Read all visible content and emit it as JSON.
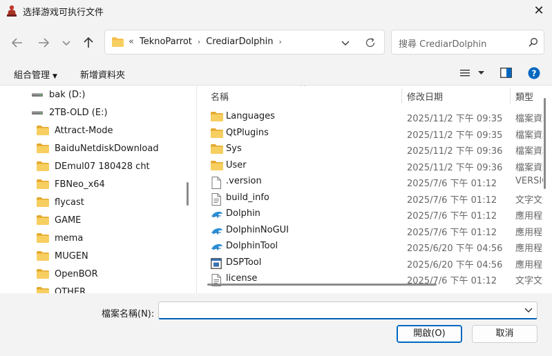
{
  "window": {
    "title": "选择游戏可执行文件",
    "icon": "app-icon",
    "close_symbol": "✕"
  },
  "nav": {
    "back_icon": "arrow-left-icon",
    "forward_icon": "arrow-right-icon",
    "recent_icon": "chevron-down-icon",
    "up_icon": "arrow-up-icon"
  },
  "address": {
    "overflow": "«",
    "crumbs": [
      "TeknoParrot",
      "CrediarDolphin"
    ],
    "sep": "›"
  },
  "search": {
    "placeholder": "搜尋 CrediarDolphin"
  },
  "toolbar": {
    "organize_label": "組合管理",
    "new_folder_label": "新增資料夾",
    "view_icon": "list-view-icon",
    "preview_icon": "preview-pane-icon",
    "help_icon": "help-icon"
  },
  "navpane": {
    "items": [
      {
        "label": "bak (D:)",
        "type": "drive"
      },
      {
        "label": "2TB-OLD (E:)",
        "type": "drive"
      },
      {
        "label": "Attract-Mode",
        "type": "folder"
      },
      {
        "label": "BaiduNetdiskDownload",
        "type": "folder"
      },
      {
        "label": "DEmul07 180428 cht",
        "type": "folder"
      },
      {
        "label": "FBNeo_x64",
        "type": "folder"
      },
      {
        "label": "flycast",
        "type": "folder"
      },
      {
        "label": "GAME",
        "type": "folder"
      },
      {
        "label": "mema",
        "type": "folder"
      },
      {
        "label": "MUGEN",
        "type": "folder"
      },
      {
        "label": "OpenBOR",
        "type": "folder"
      },
      {
        "label": "OTHER",
        "type": "folder"
      }
    ]
  },
  "columns": {
    "name": "名稱",
    "date": "修改日期",
    "type": "類型"
  },
  "files": [
    {
      "name": "Languages",
      "date": "2025/11/2 下午 09:35",
      "type": "檔案資料夾",
      "icon": "folder"
    },
    {
      "name": "QtPlugins",
      "date": "2025/11/2 下午 09:35",
      "type": "檔案資料夾",
      "icon": "folder"
    },
    {
      "name": "Sys",
      "date": "2025/11/2 下午 09:36",
      "type": "檔案資料夾",
      "icon": "folder"
    },
    {
      "name": "User",
      "date": "2025/11/2 下午 09:36",
      "type": "檔案資料夾",
      "icon": "folder"
    },
    {
      "name": ".version",
      "date": "2025/7/6 下午 01:12",
      "type": "VERSION",
      "icon": "file"
    },
    {
      "name": "build_info",
      "date": "2025/7/6 下午 01:12",
      "type": "文字文件",
      "icon": "textfile"
    },
    {
      "name": "Dolphin",
      "date": "2025/7/6 下午 01:12",
      "type": "應用程式",
      "icon": "dolphin"
    },
    {
      "name": "DolphinNoGUI",
      "date": "2025/7/6 下午 01:12",
      "type": "應用程式",
      "icon": "dolphin"
    },
    {
      "name": "DolphinTool",
      "date": "2025/6/20 下午 04:56",
      "type": "應用程式",
      "icon": "dolphin"
    },
    {
      "name": "DSPTool",
      "date": "2025/6/20 下午 04:56",
      "type": "應用程式",
      "icon": "exe"
    },
    {
      "name": "license",
      "date": "2025/7/6 下午 01:12",
      "type": "文字文件",
      "icon": "textfile"
    }
  ],
  "footer": {
    "filename_label": "檔案名稱(N):",
    "filename_value": "",
    "open_label": "開啟(O)",
    "cancel_label": "取消"
  },
  "colors": {
    "accent": "#005fb8",
    "folder": "#f4c04a",
    "folder_dark": "#e3a82b",
    "dolphin": "#2a8fd6"
  }
}
